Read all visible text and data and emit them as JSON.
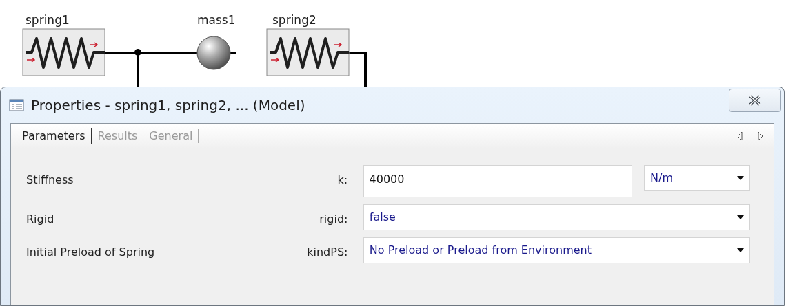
{
  "diagram": {
    "components": [
      {
        "kind": "spring",
        "label": "spring1"
      },
      {
        "kind": "mass",
        "label": "mass1"
      },
      {
        "kind": "spring",
        "label": "spring2"
      }
    ]
  },
  "dialog": {
    "title": "Properties - spring1, spring2, ... (Model)",
    "tabs": [
      {
        "label": "Parameters",
        "selected": true
      },
      {
        "label": "Results",
        "selected": false
      },
      {
        "label": "General",
        "selected": false
      }
    ],
    "rows": [
      {
        "kind": "text",
        "label": "Stiffness",
        "variable": "k:",
        "value": "40000",
        "unit": "N/m"
      },
      {
        "kind": "dropdown",
        "label": "Rigid",
        "variable": "rigid:",
        "value": "false"
      },
      {
        "kind": "dropdown",
        "label": "Initial Preload of Spring",
        "variable": "kindPS:",
        "value": "No Preload or Preload from Environment"
      }
    ]
  }
}
